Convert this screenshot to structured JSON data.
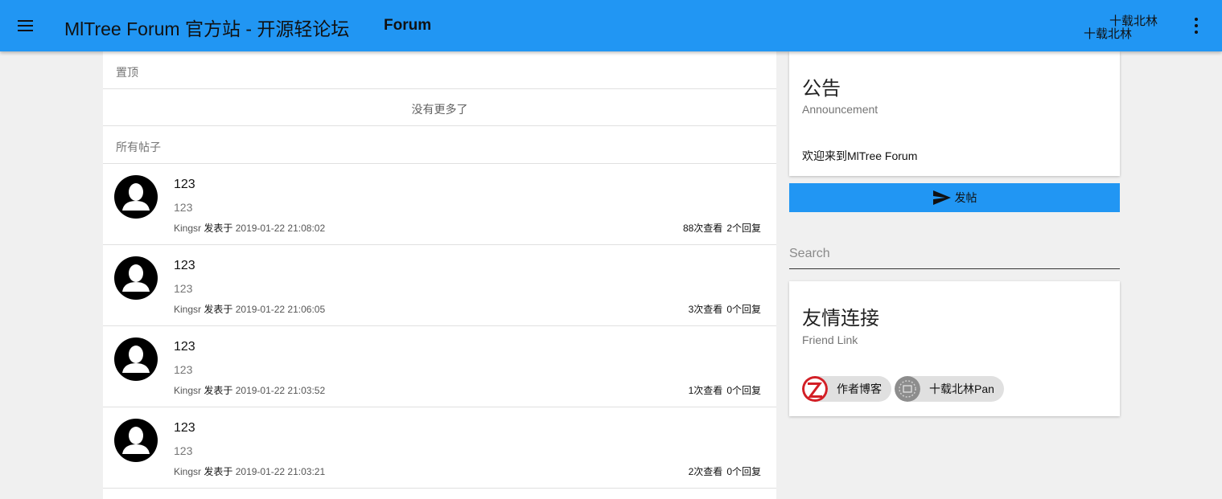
{
  "appbar": {
    "title": "MlTree Forum 官方站 - 开源轻论坛",
    "section": "Forum",
    "user_line1": "十载北林",
    "user_line2": "十载北林",
    "menu_icon": "menu-icon",
    "more_icon": "more-vert-icon"
  },
  "feed": {
    "pinned_header": "置顶",
    "no_more": "没有更多了",
    "all_header": "所有帖子",
    "posts": [
      {
        "title": "123",
        "excerpt": "123",
        "author": "Kingsr",
        "verb": "发表于",
        "time": "2019-01-22 21:08:02",
        "views": "88次查看",
        "replies": "2个回复"
      },
      {
        "title": "123",
        "excerpt": "123",
        "author": "Kingsr",
        "verb": "发表于",
        "time": "2019-01-22 21:06:05",
        "views": "3次查看",
        "replies": "0个回复"
      },
      {
        "title": "123",
        "excerpt": "123",
        "author": "Kingsr",
        "verb": "发表于",
        "time": "2019-01-22 21:03:52",
        "views": "1次查看",
        "replies": "0个回复"
      },
      {
        "title": "123",
        "excerpt": "123",
        "author": "Kingsr",
        "verb": "发表于",
        "time": "2019-01-22 21:03:21",
        "views": "2次查看",
        "replies": "0个回复"
      }
    ]
  },
  "announcement": {
    "title": "公告",
    "subtitle": "Announcement",
    "text": "欢迎来到MlTree Forum"
  },
  "post_button": {
    "label": "发帖",
    "icon": "send-icon"
  },
  "search": {
    "placeholder": "Search",
    "value": ""
  },
  "links": {
    "title": "友情连接",
    "subtitle": "Friend Link",
    "items": [
      {
        "label": "作者博客",
        "icon": "z-logo-icon"
      },
      {
        "label": "十载北林Pan",
        "icon": "pan-logo-icon"
      }
    ]
  },
  "colors": {
    "primary": "#2196f3",
    "background": "#f0f0f0",
    "chip": "#e0e0e0",
    "logo_red": "#d31f26"
  }
}
